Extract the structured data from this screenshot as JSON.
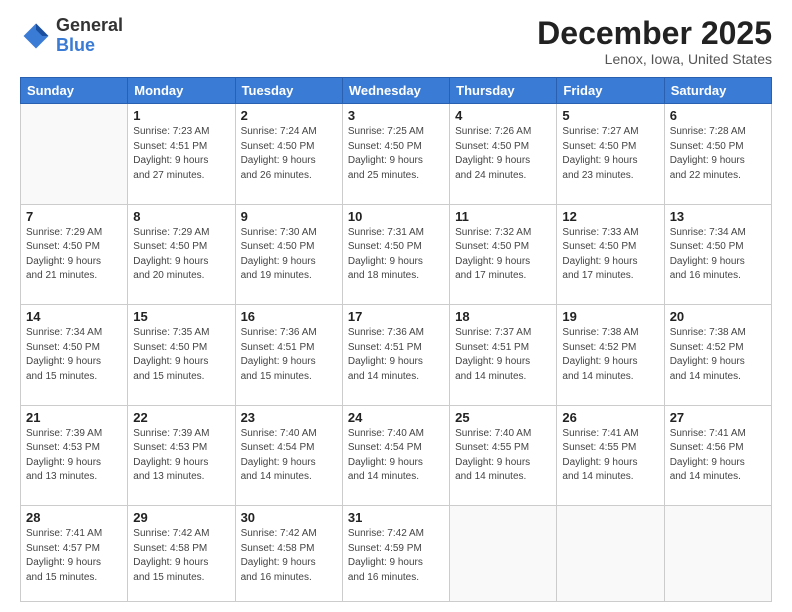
{
  "logo": {
    "general": "General",
    "blue": "Blue"
  },
  "title": "December 2025",
  "location": "Lenox, Iowa, United States",
  "days_header": [
    "Sunday",
    "Monday",
    "Tuesday",
    "Wednesday",
    "Thursday",
    "Friday",
    "Saturday"
  ],
  "weeks": [
    [
      {
        "day": "",
        "info": ""
      },
      {
        "day": "1",
        "info": "Sunrise: 7:23 AM\nSunset: 4:51 PM\nDaylight: 9 hours\nand 27 minutes."
      },
      {
        "day": "2",
        "info": "Sunrise: 7:24 AM\nSunset: 4:50 PM\nDaylight: 9 hours\nand 26 minutes."
      },
      {
        "day": "3",
        "info": "Sunrise: 7:25 AM\nSunset: 4:50 PM\nDaylight: 9 hours\nand 25 minutes."
      },
      {
        "day": "4",
        "info": "Sunrise: 7:26 AM\nSunset: 4:50 PM\nDaylight: 9 hours\nand 24 minutes."
      },
      {
        "day": "5",
        "info": "Sunrise: 7:27 AM\nSunset: 4:50 PM\nDaylight: 9 hours\nand 23 minutes."
      },
      {
        "day": "6",
        "info": "Sunrise: 7:28 AM\nSunset: 4:50 PM\nDaylight: 9 hours\nand 22 minutes."
      }
    ],
    [
      {
        "day": "7",
        "info": "Sunrise: 7:29 AM\nSunset: 4:50 PM\nDaylight: 9 hours\nand 21 minutes."
      },
      {
        "day": "8",
        "info": "Sunrise: 7:29 AM\nSunset: 4:50 PM\nDaylight: 9 hours\nand 20 minutes."
      },
      {
        "day": "9",
        "info": "Sunrise: 7:30 AM\nSunset: 4:50 PM\nDaylight: 9 hours\nand 19 minutes."
      },
      {
        "day": "10",
        "info": "Sunrise: 7:31 AM\nSunset: 4:50 PM\nDaylight: 9 hours\nand 18 minutes."
      },
      {
        "day": "11",
        "info": "Sunrise: 7:32 AM\nSunset: 4:50 PM\nDaylight: 9 hours\nand 17 minutes."
      },
      {
        "day": "12",
        "info": "Sunrise: 7:33 AM\nSunset: 4:50 PM\nDaylight: 9 hours\nand 17 minutes."
      },
      {
        "day": "13",
        "info": "Sunrise: 7:34 AM\nSunset: 4:50 PM\nDaylight: 9 hours\nand 16 minutes."
      }
    ],
    [
      {
        "day": "14",
        "info": "Sunrise: 7:34 AM\nSunset: 4:50 PM\nDaylight: 9 hours\nand 15 minutes."
      },
      {
        "day": "15",
        "info": "Sunrise: 7:35 AM\nSunset: 4:50 PM\nDaylight: 9 hours\nand 15 minutes."
      },
      {
        "day": "16",
        "info": "Sunrise: 7:36 AM\nSunset: 4:51 PM\nDaylight: 9 hours\nand 15 minutes."
      },
      {
        "day": "17",
        "info": "Sunrise: 7:36 AM\nSunset: 4:51 PM\nDaylight: 9 hours\nand 14 minutes."
      },
      {
        "day": "18",
        "info": "Sunrise: 7:37 AM\nSunset: 4:51 PM\nDaylight: 9 hours\nand 14 minutes."
      },
      {
        "day": "19",
        "info": "Sunrise: 7:38 AM\nSunset: 4:52 PM\nDaylight: 9 hours\nand 14 minutes."
      },
      {
        "day": "20",
        "info": "Sunrise: 7:38 AM\nSunset: 4:52 PM\nDaylight: 9 hours\nand 14 minutes."
      }
    ],
    [
      {
        "day": "21",
        "info": "Sunrise: 7:39 AM\nSunset: 4:53 PM\nDaylight: 9 hours\nand 13 minutes."
      },
      {
        "day": "22",
        "info": "Sunrise: 7:39 AM\nSunset: 4:53 PM\nDaylight: 9 hours\nand 13 minutes."
      },
      {
        "day": "23",
        "info": "Sunrise: 7:40 AM\nSunset: 4:54 PM\nDaylight: 9 hours\nand 14 minutes."
      },
      {
        "day": "24",
        "info": "Sunrise: 7:40 AM\nSunset: 4:54 PM\nDaylight: 9 hours\nand 14 minutes."
      },
      {
        "day": "25",
        "info": "Sunrise: 7:40 AM\nSunset: 4:55 PM\nDaylight: 9 hours\nand 14 minutes."
      },
      {
        "day": "26",
        "info": "Sunrise: 7:41 AM\nSunset: 4:55 PM\nDaylight: 9 hours\nand 14 minutes."
      },
      {
        "day": "27",
        "info": "Sunrise: 7:41 AM\nSunset: 4:56 PM\nDaylight: 9 hours\nand 14 minutes."
      }
    ],
    [
      {
        "day": "28",
        "info": "Sunrise: 7:41 AM\nSunset: 4:57 PM\nDaylight: 9 hours\nand 15 minutes."
      },
      {
        "day": "29",
        "info": "Sunrise: 7:42 AM\nSunset: 4:58 PM\nDaylight: 9 hours\nand 15 minutes."
      },
      {
        "day": "30",
        "info": "Sunrise: 7:42 AM\nSunset: 4:58 PM\nDaylight: 9 hours\nand 16 minutes."
      },
      {
        "day": "31",
        "info": "Sunrise: 7:42 AM\nSunset: 4:59 PM\nDaylight: 9 hours\nand 16 minutes."
      },
      {
        "day": "",
        "info": ""
      },
      {
        "day": "",
        "info": ""
      },
      {
        "day": "",
        "info": ""
      }
    ]
  ]
}
